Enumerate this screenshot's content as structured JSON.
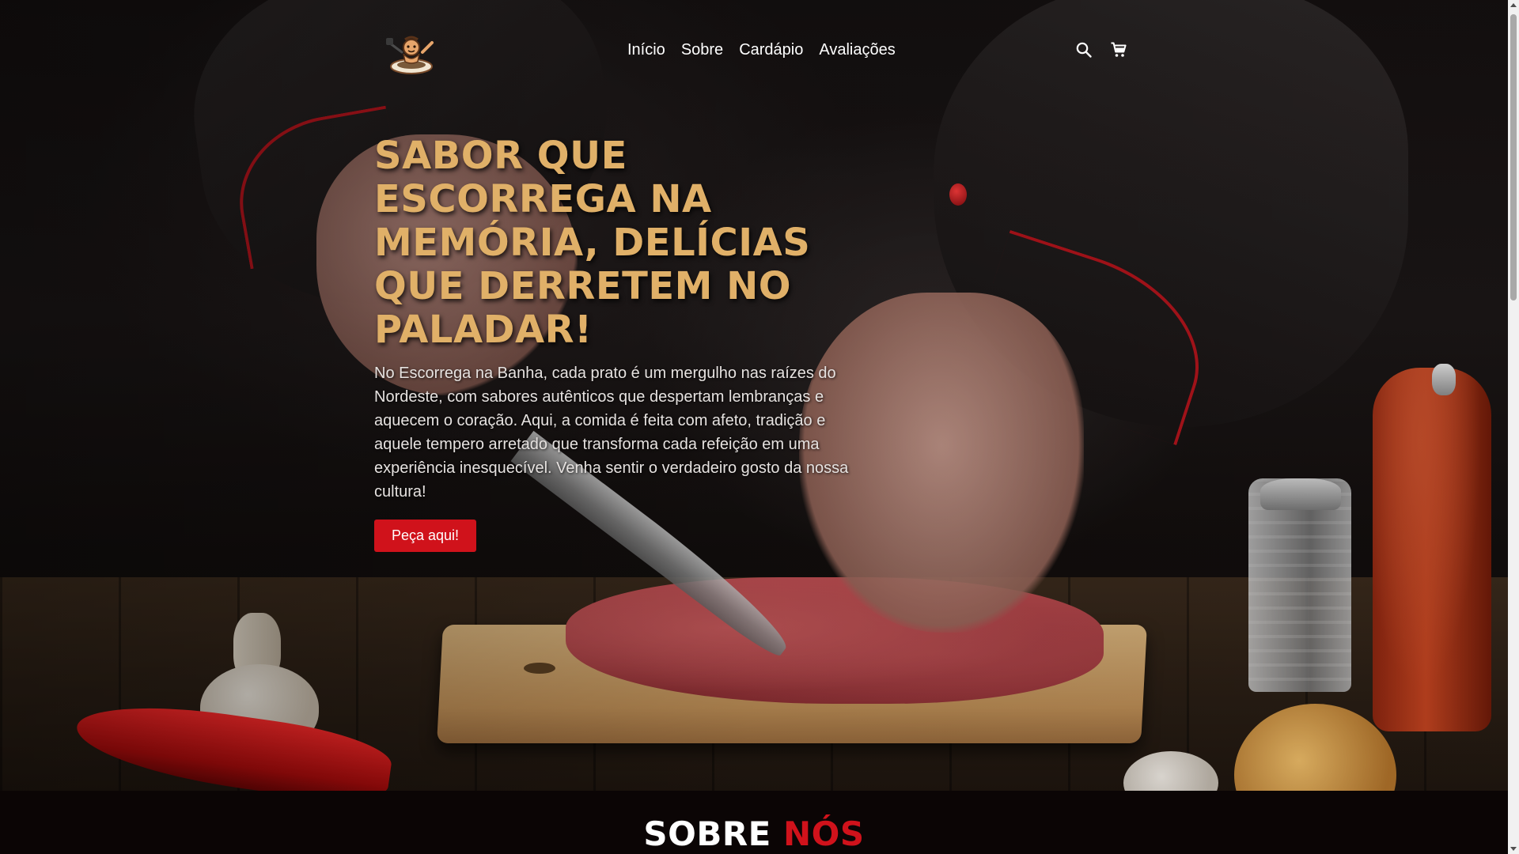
{
  "header": {
    "logo_icon": "chef-cooking-logo",
    "nav": [
      {
        "label": "Início"
      },
      {
        "label": "Sobre"
      },
      {
        "label": "Cardápio"
      },
      {
        "label": "Avaliações"
      }
    ],
    "icons": [
      "search-icon",
      "cart-icon"
    ]
  },
  "hero": {
    "title": "SABOR QUE ESCORREGA NA MEMÓRIA, DELÍCIAS QUE DERRETEM NO PALADAR!",
    "description": "No Escorrega na Banha, cada prato é um mergulho nas raízes do Nordeste, com sabores autênticos que despertam lembranças e aquecem o coração. Aqui, a comida é feita com afeto, tradição e aquele tempero arretado que transforma cada refeição em uma experiência inesquecível. Venha sentir o verdadeiro gosto da nossa cultura!",
    "cta_label": "Peça aqui!"
  },
  "about": {
    "title_part1": "SOBRE",
    "title_part2": "NÓS"
  },
  "colors": {
    "accent_red": "#d0121b",
    "title_gold": "#e0b068",
    "background": "#0b0505"
  }
}
